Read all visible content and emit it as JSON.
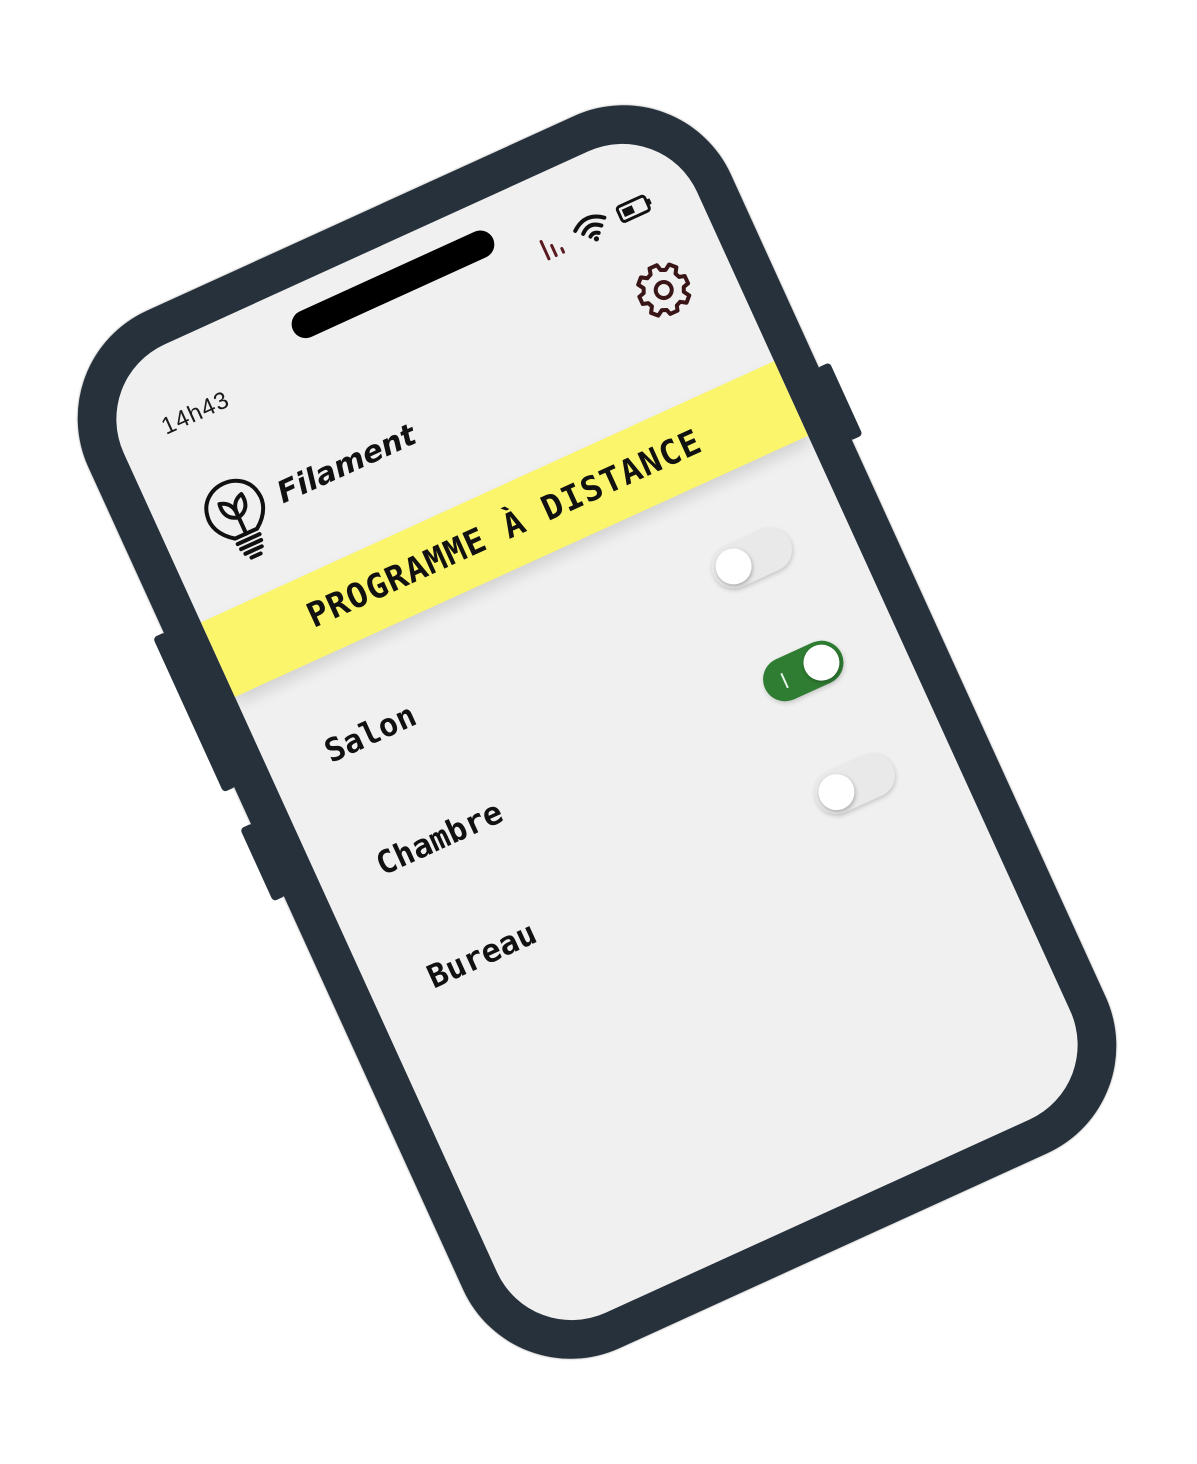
{
  "status_bar": {
    "time": "14h43",
    "signal_icon": "signal-icon",
    "wifi_icon": "wifi-icon",
    "battery_icon": "battery-icon"
  },
  "header": {
    "logo_icon": "lightbulb-icon",
    "app_name": "Filament",
    "settings_icon": "gear-icon"
  },
  "banner": {
    "title": "PROGRAMME À DISTANCE",
    "color": "#fbf56b"
  },
  "rooms": [
    {
      "label": "Salon",
      "on": false
    },
    {
      "label": "Chambre",
      "on": true
    },
    {
      "label": "Bureau",
      "on": false
    }
  ],
  "colors": {
    "phone_body": "#27313b",
    "screen_bg": "#f0f0f0",
    "toggle_on": "#2e7d32",
    "gear": "#3a1518"
  }
}
